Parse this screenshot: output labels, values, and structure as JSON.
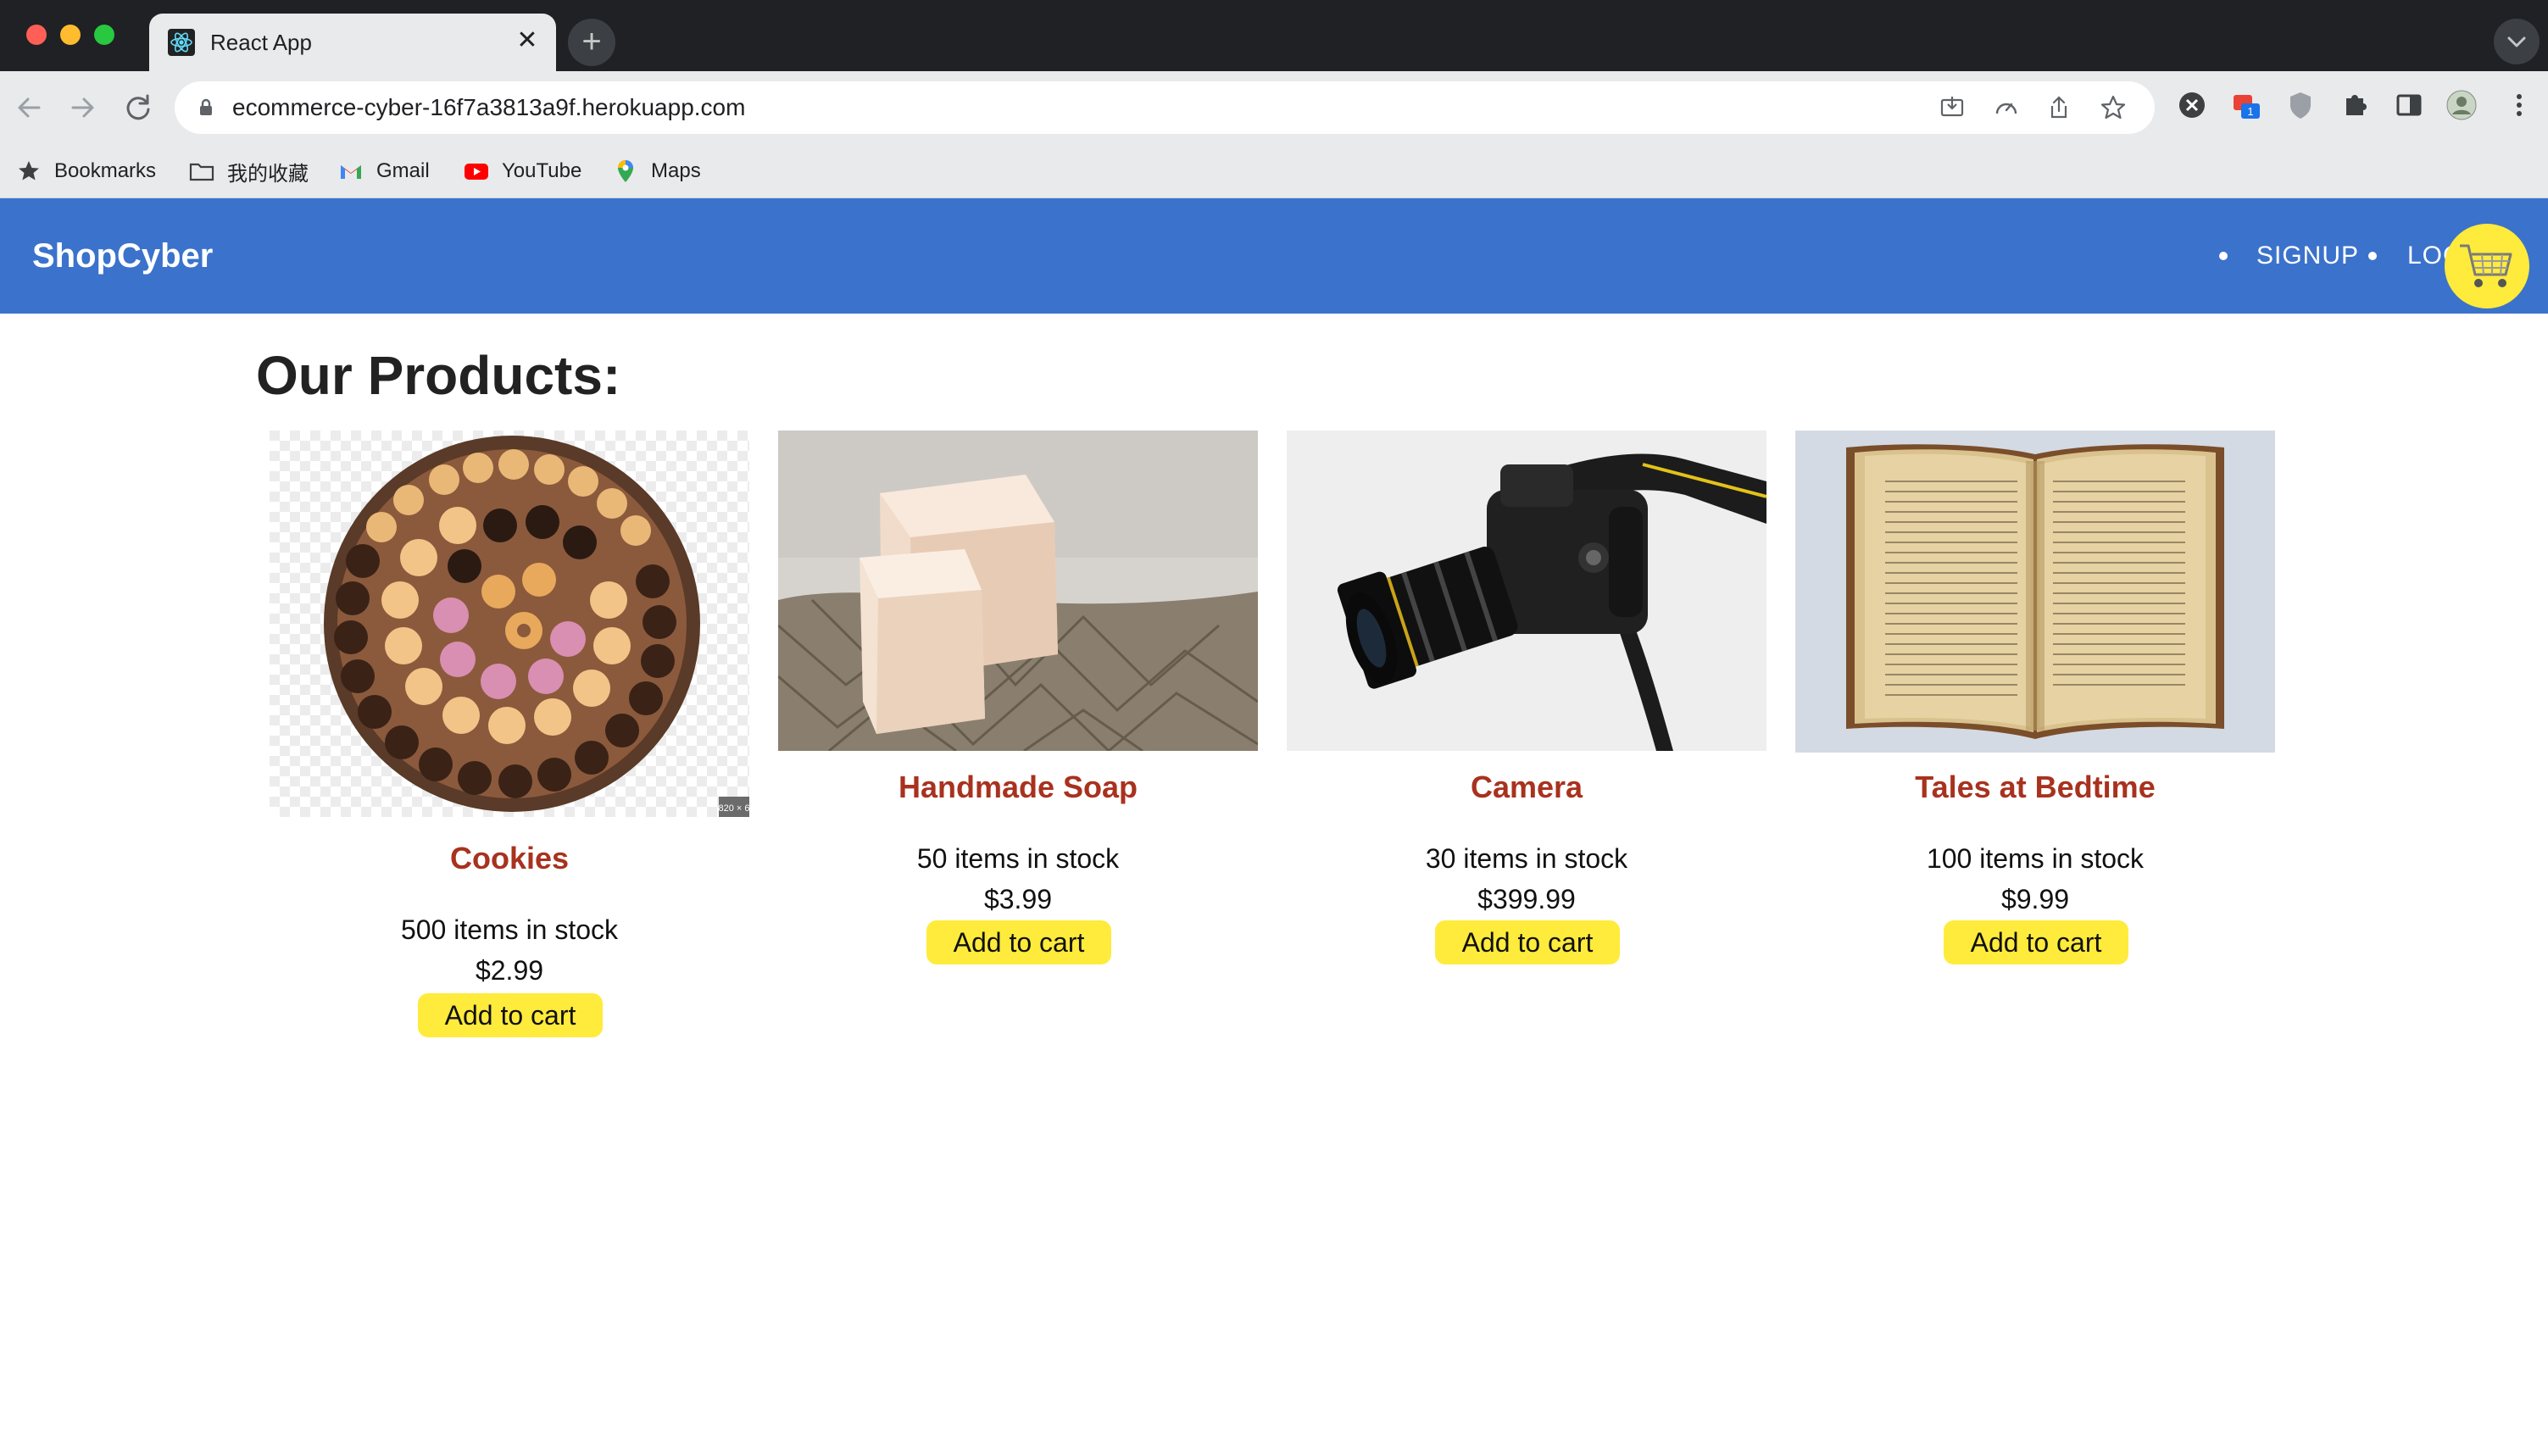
{
  "browser": {
    "tab_title": "React App",
    "url": "ecommerce-cyber-16f7a3813a9f.herokuapp.com",
    "extension_badge": "1",
    "bookmarks": [
      {
        "label": "Bookmarks",
        "icon": "star-icon"
      },
      {
        "label": "我的收藏",
        "icon": "folder-icon"
      },
      {
        "label": "Gmail",
        "icon": "gmail-icon"
      },
      {
        "label": "YouTube",
        "icon": "youtube-icon"
      },
      {
        "label": "Maps",
        "icon": "maps-icon"
      }
    ]
  },
  "app": {
    "brand": "ShopCyber",
    "nav": {
      "signup": "SIGNUP",
      "login": "LOGIN"
    },
    "heading": "Our Products:",
    "colors": {
      "header": "#3b72cc",
      "accent": "#ffeb3b",
      "title": "#a8321e"
    }
  },
  "products": [
    {
      "name": "Cookies",
      "stock": "500 items in stock",
      "price": "$2.99",
      "button": "Add to cart",
      "image": "cookies-image",
      "watermark": "820 × 6"
    },
    {
      "name": "Handmade Soap",
      "stock": "50 items in stock",
      "price": "$3.99",
      "button": "Add to cart",
      "image": "soap-image"
    },
    {
      "name": "Camera",
      "stock": "30 items in stock",
      "price": "$399.99",
      "button": "Add to cart",
      "image": "camera-image"
    },
    {
      "name": "Tales at Bedtime",
      "stock": "100 items in stock",
      "price": "$9.99",
      "button": "Add to cart",
      "image": "book-image"
    }
  ]
}
